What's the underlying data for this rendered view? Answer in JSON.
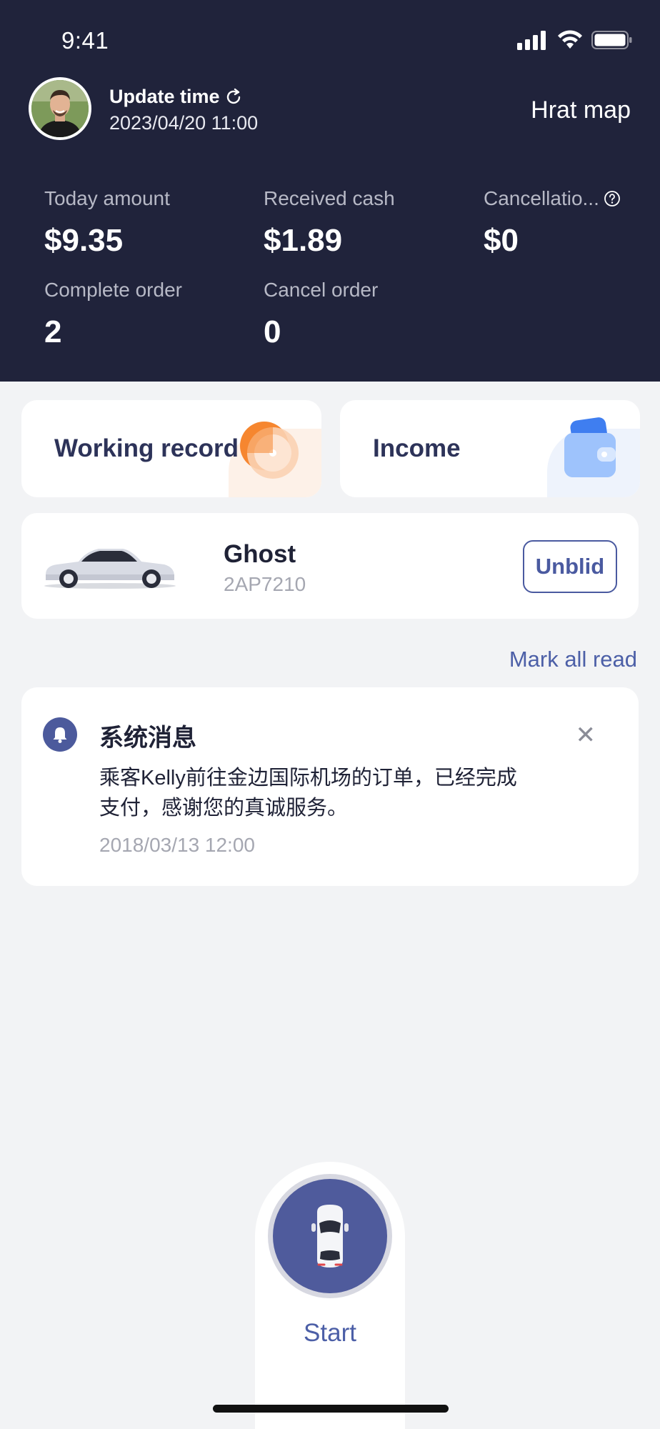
{
  "status_bar": {
    "time": "9:41"
  },
  "header": {
    "update_label": "Update time",
    "update_time": "2023/04/20 11:00",
    "heat_map_label": "Hrat map"
  },
  "stats": [
    {
      "label": "Today amount",
      "value": "$9.35"
    },
    {
      "label": "Received cash",
      "value": "$1.89"
    },
    {
      "label": "Cancellatio...",
      "value": "$0"
    },
    {
      "label": "Complete order",
      "value": "2"
    },
    {
      "label": "Cancel order",
      "value": "0"
    }
  ],
  "quick_cards": {
    "working_record": "Working record",
    "income": "Income"
  },
  "vehicle": {
    "name": "Ghost",
    "plate": "2AP7210",
    "unbind_label": "Unblid"
  },
  "messages": {
    "mark_all_read": "Mark all read",
    "items": [
      {
        "title": "系统消息",
        "body": "乘客Kelly前往金边国际机场的订单，已经完成支付，感谢您的真诚服务。",
        "time": "2018/03/13 12:00"
      }
    ]
  },
  "start": {
    "label": "Start"
  },
  "colors": {
    "header_bg": "#20233b",
    "accent": "#4c5a9c",
    "orange": "#f6862f",
    "page_bg": "#f2f3f5"
  }
}
